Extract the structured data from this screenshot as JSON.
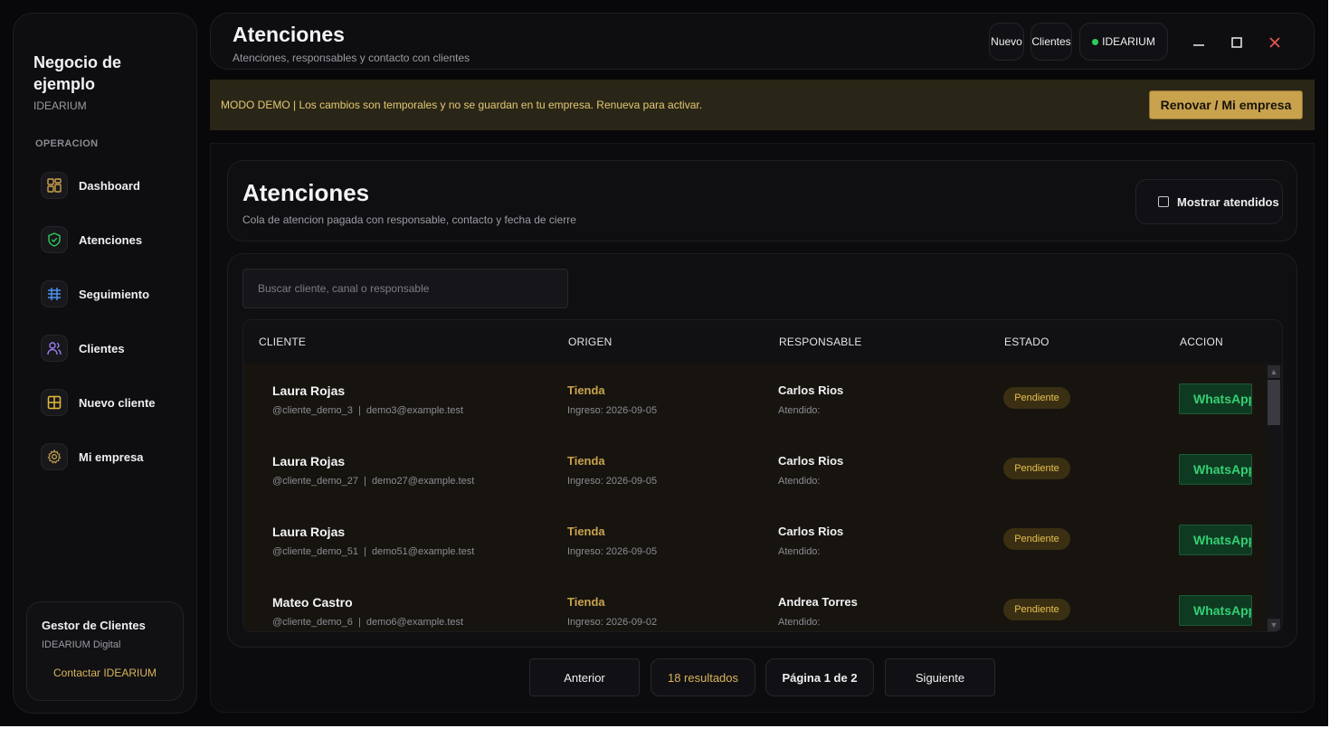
{
  "sidebar": {
    "brand_title": "Negocio de ejemplo",
    "brand_sub": "IDEARIUM",
    "section_label": "OPERACION",
    "items": [
      {
        "label": "Dashboard",
        "icon": "dashboard-icon"
      },
      {
        "label": "Atenciones",
        "icon": "shield-check-icon"
      },
      {
        "label": "Seguimiento",
        "icon": "table-grid-icon"
      },
      {
        "label": "Clientes",
        "icon": "users-icon"
      },
      {
        "label": "Nuevo cliente",
        "icon": "add-grid-icon"
      },
      {
        "label": "Mi empresa",
        "icon": "gear-icon"
      }
    ],
    "card": {
      "title": "Gestor de Clientes",
      "subtitle": "IDEARIUM Digital",
      "link": "Contactar IDEARIUM"
    }
  },
  "topbar": {
    "title": "Atenciones",
    "subtitle": "Atenciones, responsables y contacto con clientes",
    "btn_nuevo": "Nuevo",
    "btn_clientes": "Clientes",
    "status_label": "IDEARIUM"
  },
  "banner": {
    "text": "MODO DEMO | Los cambios son temporales y no se guardan en tu empresa. Renueva para activar.",
    "button": "Renovar / Mi empresa"
  },
  "header": {
    "title": "Atenciones",
    "subtitle": "Cola de atencion pagada con responsable, contacto y fecha de cierre",
    "toggle_label": "Mostrar atendidos"
  },
  "search": {
    "placeholder": "Buscar cliente, canal o responsable"
  },
  "table": {
    "columns": [
      "CLIENTE",
      "ORIGEN",
      "RESPONSABLE",
      "ESTADO",
      "ACCION"
    ],
    "rows": [
      {
        "name": "Laura Rojas",
        "meta": "@cliente_demo_3  |  demo3@example.test",
        "origin": "Tienda",
        "ingreso": "Ingreso: 2026-09-05",
        "responsable": "Carlos Rios",
        "atendido": "Atendido:",
        "estado": "Pendiente",
        "accion": "WhatsApp"
      },
      {
        "name": "Laura Rojas",
        "meta": "@cliente_demo_27  |  demo27@example.test",
        "origin": "Tienda",
        "ingreso": "Ingreso: 2026-09-05",
        "responsable": "Carlos Rios",
        "atendido": "Atendido:",
        "estado": "Pendiente",
        "accion": "WhatsApp"
      },
      {
        "name": "Laura Rojas",
        "meta": "@cliente_demo_51  |  demo51@example.test",
        "origin": "Tienda",
        "ingreso": "Ingreso: 2026-09-05",
        "responsable": "Carlos Rios",
        "atendido": "Atendido:",
        "estado": "Pendiente",
        "accion": "WhatsApp"
      },
      {
        "name": "Mateo Castro",
        "meta": "@cliente_demo_6  |  demo6@example.test",
        "origin": "Tienda",
        "ingreso": "Ingreso: 2026-09-02",
        "responsable": "Andrea Torres",
        "atendido": "Atendido:",
        "estado": "Pendiente",
        "accion": "WhatsApp"
      }
    ]
  },
  "pagination": {
    "prev": "Anterior",
    "results": "18 resultados",
    "page": "Página 1 de 2",
    "next": "Siguiente"
  },
  "colors": {
    "accent_gold": "#c9a24e",
    "whatsapp_green": "#35d073",
    "status_online": "#2ecc5a",
    "close_red": "#e0564f"
  }
}
